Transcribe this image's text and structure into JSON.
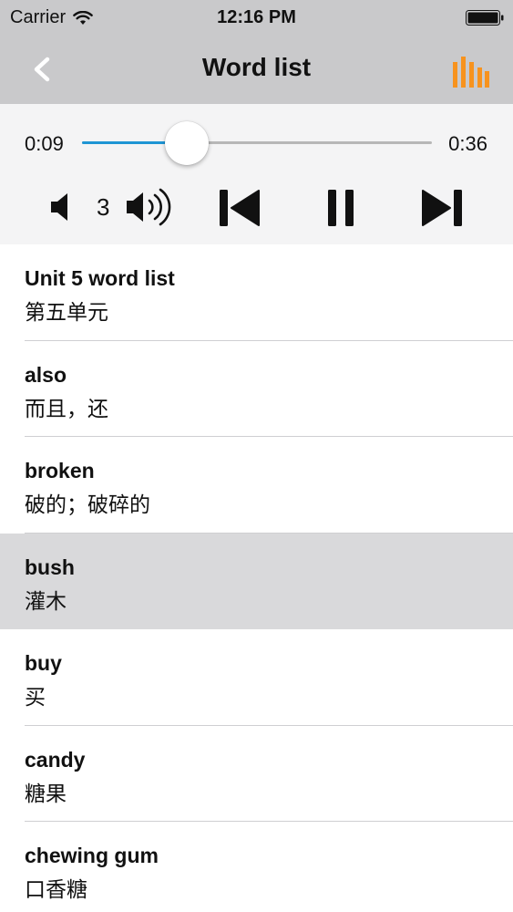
{
  "status_bar": {
    "carrier": "Carrier",
    "time": "12:16 PM",
    "wifi_icon": "wifi-icon",
    "battery_icon": "battery-icon"
  },
  "nav": {
    "title": "Word list",
    "back_icon": "chevron-left-icon",
    "equalizer_icon": "equalizer-icon",
    "accent_color": "#f7931e"
  },
  "player": {
    "elapsed": "0:09",
    "total": "0:36",
    "progress": 0.3,
    "progress_color": "#1e95d4",
    "volume_level": "3"
  },
  "words": [
    {
      "en": "Unit 5 word list",
      "cn": "第五单元",
      "selected": false
    },
    {
      "en": "also",
      "cn": "而且，还",
      "selected": false
    },
    {
      "en": "broken",
      "cn": "破的；破碎的",
      "selected": false
    },
    {
      "en": "bush",
      "cn": "灌木",
      "selected": true
    },
    {
      "en": "buy",
      "cn": "买",
      "selected": false
    },
    {
      "en": "candy",
      "cn": "糖果",
      "selected": false
    },
    {
      "en": "chewing gum",
      "cn": "口香糖",
      "selected": false
    }
  ]
}
